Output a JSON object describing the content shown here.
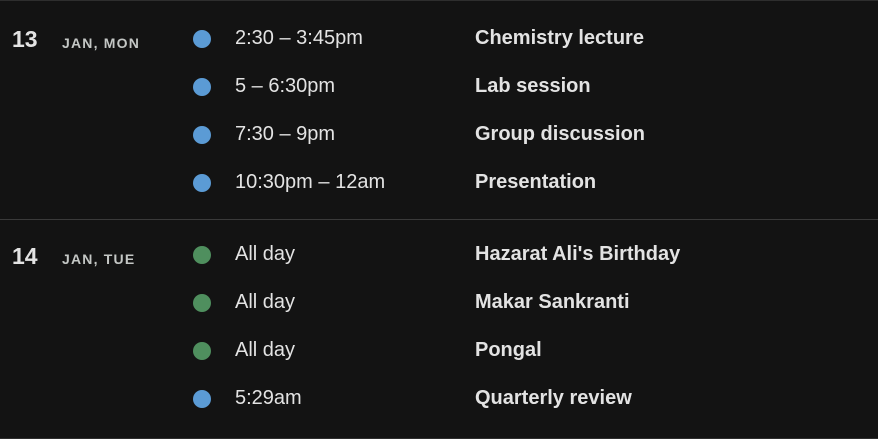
{
  "colors": {
    "background": "#131313",
    "blue_calendar": "#5b9bd5",
    "green_calendar": "#4f8f5e"
  },
  "days": [
    {
      "day_number": "13",
      "day_label": "JAN, MON",
      "events": [
        {
          "time": "2:30 – 3:45pm",
          "title": "Chemistry lecture",
          "color": "#5b9bd5"
        },
        {
          "time": "5 – 6:30pm",
          "title": "Lab session",
          "color": "#5b9bd5"
        },
        {
          "time": "7:30 – 9pm",
          "title": "Group discussion",
          "color": "#5b9bd5"
        },
        {
          "time": "10:30pm – 12am",
          "title": "Presentation",
          "color": "#5b9bd5"
        }
      ]
    },
    {
      "day_number": "14",
      "day_label": "JAN, TUE",
      "events": [
        {
          "time": "All day",
          "title": "Hazarat Ali's Birthday",
          "color": "#4f8f5e"
        },
        {
          "time": "All day",
          "title": "Makar Sankranti",
          "color": "#4f8f5e"
        },
        {
          "time": "All day",
          "title": "Pongal",
          "color": "#4f8f5e"
        },
        {
          "time": "5:29am",
          "title": "Quarterly review",
          "color": "#5b9bd5"
        }
      ]
    }
  ]
}
